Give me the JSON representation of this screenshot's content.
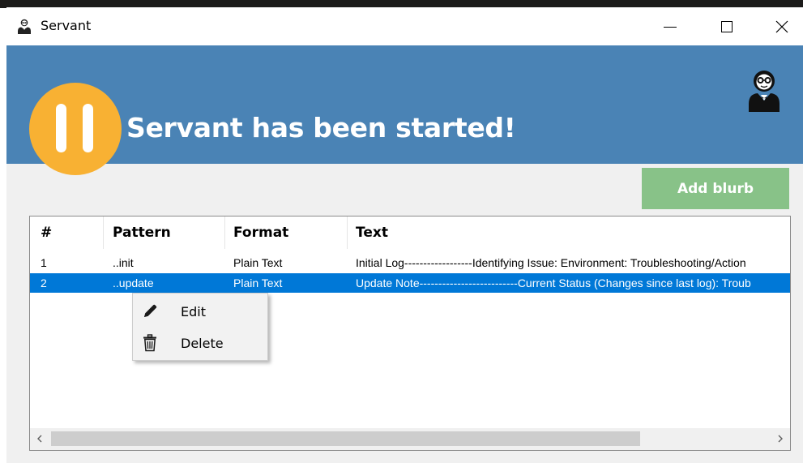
{
  "window": {
    "title": "Servant",
    "controls": {
      "minimize": "minimize",
      "maximize": "maximize",
      "close": "close"
    }
  },
  "banner": {
    "status_message": "Servant has been started!",
    "status_icon": "pause-icon",
    "mascot_icon": "butler-icon",
    "background": "#4a83b5",
    "status_color": "#f8b133"
  },
  "toolbar": {
    "add_label": "Add blurb",
    "add_color": "#88c288"
  },
  "table": {
    "columns": [
      "#",
      "Pattern",
      "Format",
      "Text"
    ],
    "rows": [
      {
        "num": "1",
        "pattern": "..init",
        "format": "Plain Text",
        "text": "Initial Log------------------Identifying Issue: Environment: Troubleshooting/Action",
        "selected": false
      },
      {
        "num": "2",
        "pattern": "..update",
        "format": "Plain Text",
        "text": "Update Note--------------------------Current Status (Changes since last log): Troub",
        "selected": true
      }
    ],
    "selection_color": "#0078d7"
  },
  "context_menu": {
    "items": [
      {
        "label": "Edit",
        "icon": "pencil-icon"
      },
      {
        "label": "Delete",
        "icon": "trash-icon"
      }
    ]
  }
}
